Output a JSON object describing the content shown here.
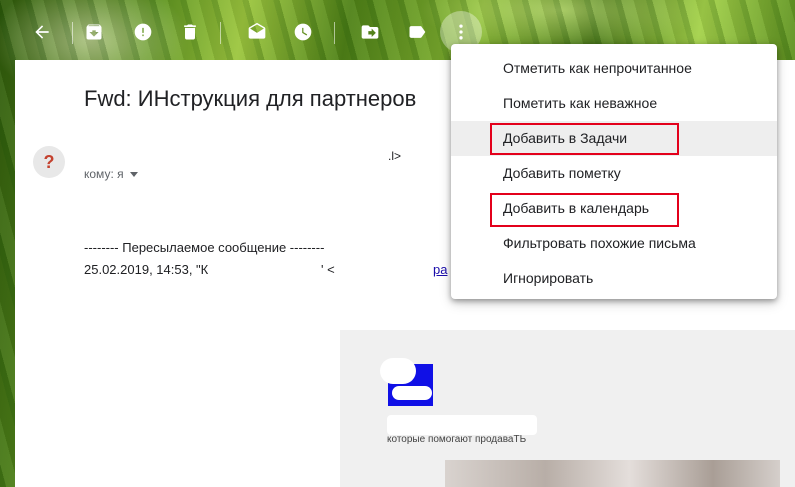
{
  "toolbar": {
    "buttons": [
      {
        "icon": "back-arrow-icon",
        "tooltip": ""
      },
      {
        "icon": "archive-icon"
      },
      {
        "icon": "report-spam-icon"
      },
      {
        "icon": "delete-icon"
      },
      {
        "icon": "mark-unread-icon"
      },
      {
        "icon": "snooze-clock-icon"
      },
      {
        "icon": "move-to-icon"
      },
      {
        "icon": "label-icon"
      },
      {
        "icon": "more-vert-icon"
      }
    ]
  },
  "email": {
    "subject": "Fwd: ИНструкция для партнеров",
    "avatar_glyph": "?",
    "sender_tail": ".l>",
    "to_label": "кому: я",
    "forward_header": "-------- Пересылаемое сообщение --------",
    "forward_date": "25.02.2019, 14:53, \"К",
    "forward_mark1": "' <",
    "forward_mark2": "ра",
    "embed_text": "которые помогают продаваТЬ"
  },
  "menu": {
    "items": [
      {
        "label": "Отметить как непрочитанное",
        "highlighted": false,
        "hover": false
      },
      {
        "label": "Пометить как неважное",
        "highlighted": false,
        "hover": false
      },
      {
        "label": "Добавить в Задачи",
        "highlighted": true,
        "hover": true
      },
      {
        "label": "Добавить пометку",
        "highlighted": false,
        "hover": false
      },
      {
        "label": "Добавить в календарь",
        "highlighted": true,
        "hover": false
      },
      {
        "label": "Фильтровать похожие письма",
        "highlighted": false,
        "hover": false
      },
      {
        "label": "Игнорировать",
        "highlighted": false,
        "hover": false
      }
    ]
  },
  "colors": {
    "highlight_box": "#e3001b",
    "menu_hover": "#eeeeee",
    "avatar_question": "#c4422f"
  }
}
